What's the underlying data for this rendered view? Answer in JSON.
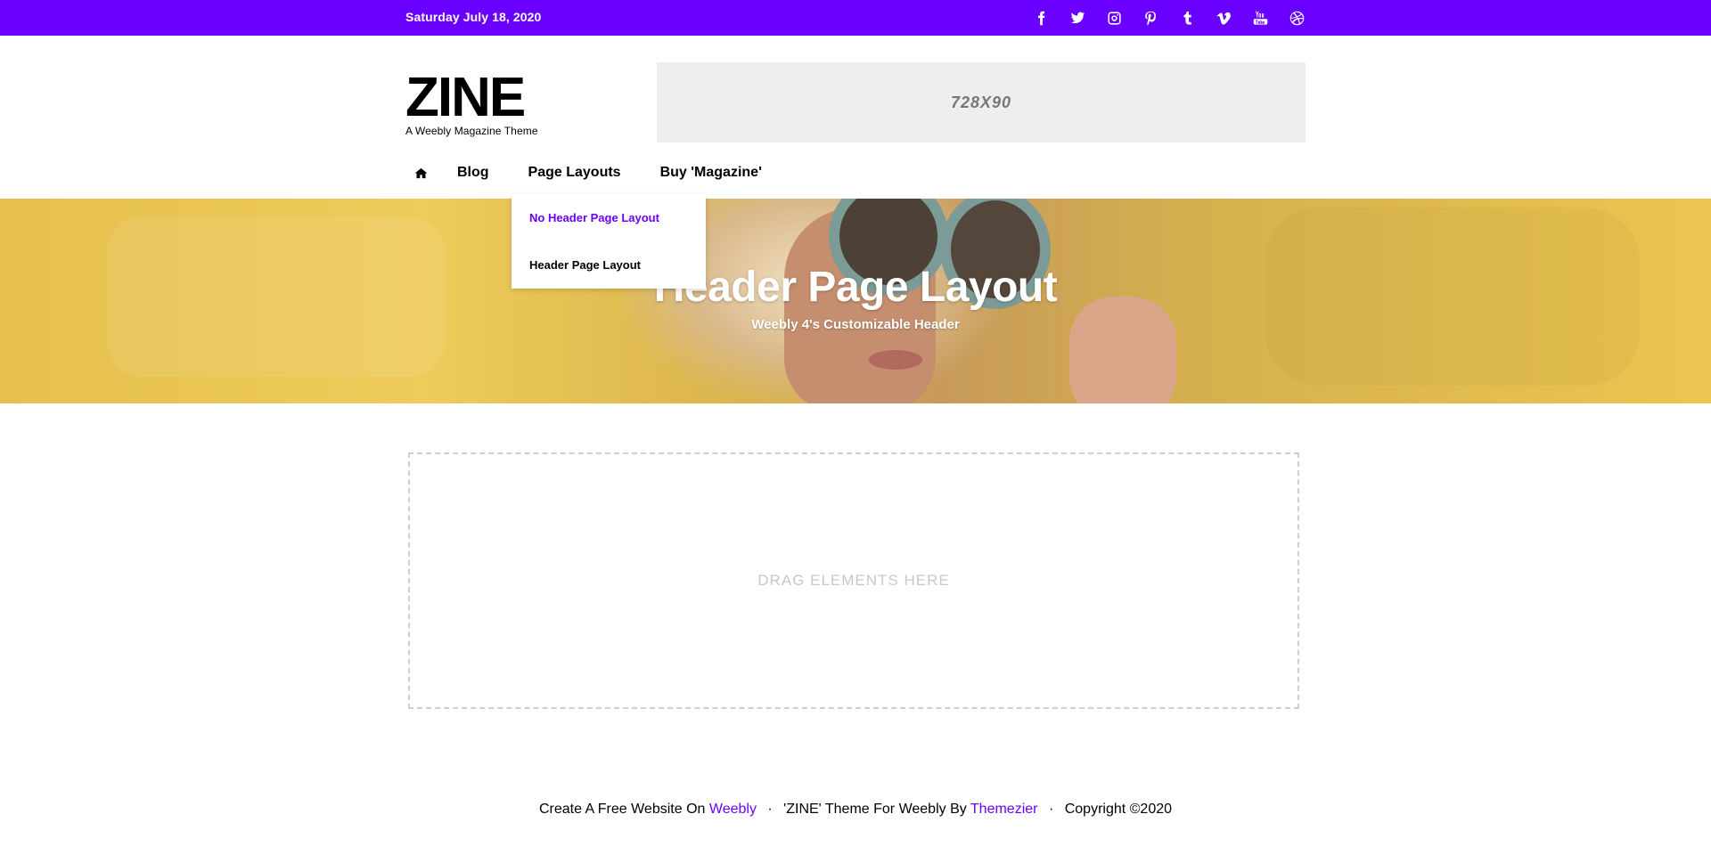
{
  "topbar": {
    "date": "Saturday July 18, 2020",
    "socials": [
      {
        "icon": "facebook-icon"
      },
      {
        "icon": "twitter-icon"
      },
      {
        "icon": "instagram-icon"
      },
      {
        "icon": "pinterest-icon"
      },
      {
        "icon": "tumblr-icon"
      },
      {
        "icon": "vimeo-icon"
      },
      {
        "icon": "youtube-icon"
      },
      {
        "icon": "dribbble-icon"
      }
    ],
    "color": "#6a00ff"
  },
  "logo": {
    "name": "ZINE",
    "tagline": "A Weebly Magazine Theme"
  },
  "ad": {
    "label": "728X90"
  },
  "nav": {
    "home_icon": "home-icon",
    "items": [
      "Blog",
      "Page Layouts",
      "Buy 'Magazine'"
    ]
  },
  "dropdown": {
    "items": [
      "No Header Page Layout",
      "Header Page Layout"
    ]
  },
  "hero": {
    "title": "Header Page Layout",
    "subtitle": "Weebly 4's Customizable Header"
  },
  "dropzone": {
    "label": "DRAG ELEMENTS HERE"
  },
  "footer": {
    "text1": "Create A Free Website On",
    "link1": "Weebly",
    "sep": "·",
    "text2": "'ZINE' Theme For Weebly By",
    "link2": "Themezier",
    "text3": "Copyright ©2020"
  }
}
